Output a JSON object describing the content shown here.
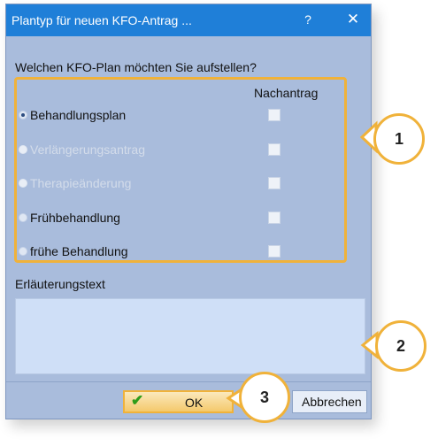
{
  "window": {
    "title": "Plantyp für neuen KFO-Antrag ...",
    "help_label": "?",
    "close_label": "✕"
  },
  "question": "Welchen KFO-Plan möchten Sie aufstellen?",
  "column_header": "Nachantrag",
  "options": [
    {
      "label": "Behandlungsplan",
      "selected": true,
      "enabled": true
    },
    {
      "label": "Verlängerungsantrag",
      "selected": false,
      "enabled": false
    },
    {
      "label": "Therapieänderung",
      "selected": false,
      "enabled": false
    },
    {
      "label": "Frühbehandlung",
      "selected": false,
      "enabled": true
    },
    {
      "label": "frühe Behandlung",
      "selected": false,
      "enabled": true
    }
  ],
  "explanation": {
    "label": "Erläuterungstext",
    "value": ""
  },
  "buttons": {
    "ok_label": "OK",
    "cancel_label": "Abbrechen"
  },
  "callouts": [
    "1",
    "2",
    "3"
  ],
  "colors": {
    "titlebar": "#1f7fd8",
    "dialog_bg": "#a9bcdc",
    "highlight": "#f0b23a",
    "textarea_bg": "#cfdff7"
  }
}
